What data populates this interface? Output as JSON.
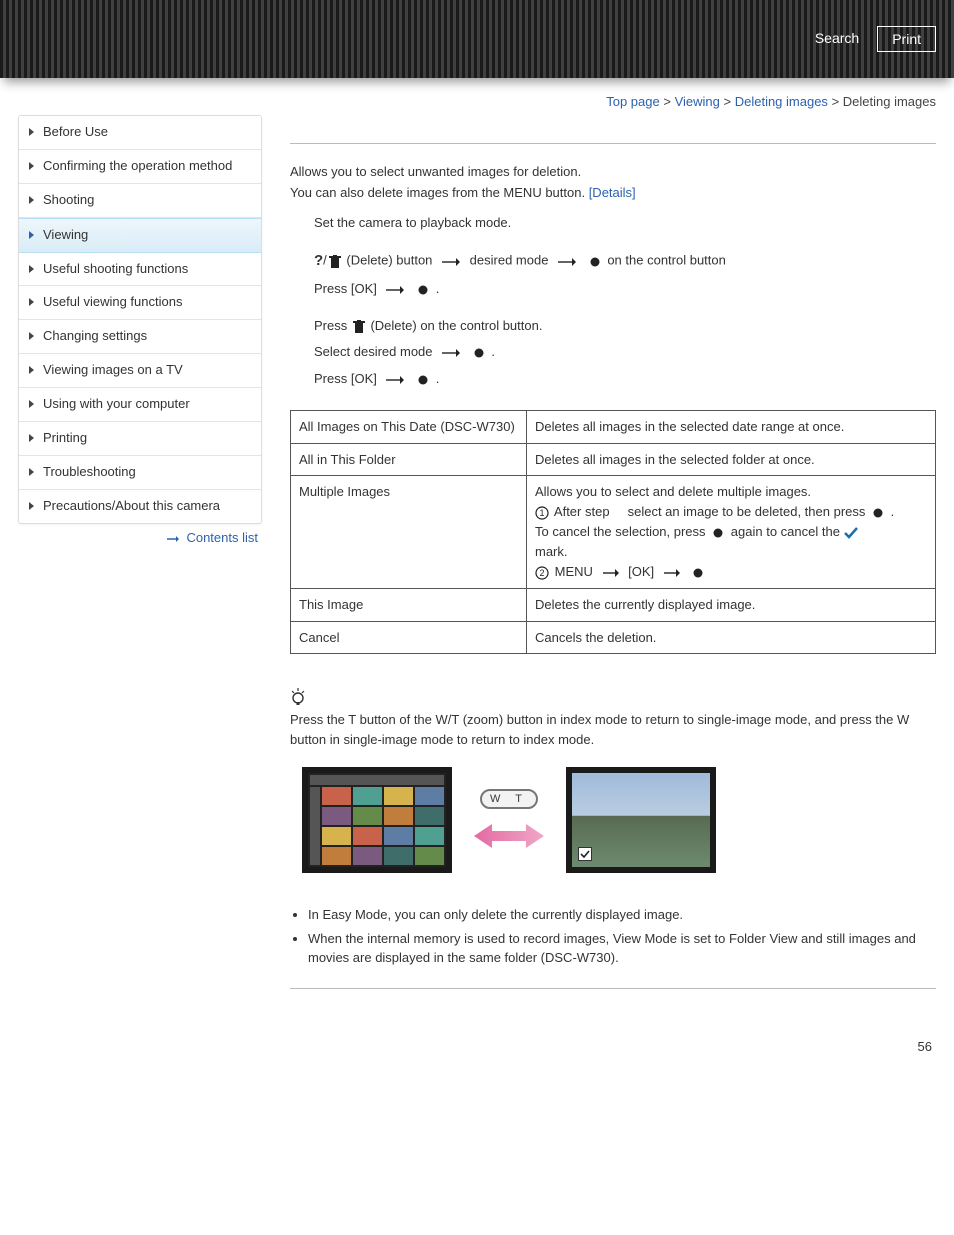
{
  "header": {
    "search": "Search",
    "print": "Print"
  },
  "breadcrumb": {
    "top": "Top page",
    "viewing": "Viewing",
    "deleting": "Deleting images",
    "current": "Deleting images",
    "sep": ">"
  },
  "sidebar": {
    "items": [
      "Before Use",
      "Confirming the operation method",
      "Shooting",
      "Viewing",
      "Useful shooting functions",
      "Useful viewing functions",
      "Changing settings",
      "Viewing images on a TV",
      "Using with your computer",
      "Printing",
      "Troubleshooting",
      "Precautions/About this camera"
    ],
    "contents_list": "Contents list"
  },
  "intro": {
    "line1": "Allows you to select unwanted images for deletion.",
    "line2": "You can also delete images from the MENU button. ",
    "details": "[Details]"
  },
  "steps": {
    "playback": "Set the camera to playback mode.",
    "delete_btn": "(Delete) button",
    "desired_mode": "desired mode",
    "on_control": "on the control button",
    "press_ok": "Press [OK]",
    "dot": ".",
    "press_delete_ctrl": "(Delete) on the control button.",
    "press": "Press ",
    "select_desired": "Select desired mode"
  },
  "table": {
    "r1c1": "All Images on This Date (DSC-W730)",
    "r1c2": "Deletes all images in the selected date range at once.",
    "r2c1": "All in This Folder",
    "r2c2": "Deletes all images in the selected folder at once.",
    "r3c1": "Multiple Images",
    "r3c2_l1": "Allows you to select and delete multiple images.",
    "r3c2_after": "After step",
    "r3c2_select": "select an image to be deleted, then press",
    "r3c2_cancel1": "To cancel the selection, press",
    "r3c2_cancel2": "again to cancel the",
    "r3c2_mark": "mark.",
    "r3c2_menu": "MENU",
    "r3c2_ok": "[OK]",
    "r4c1": "This Image",
    "r4c2": "Deletes the currently displayed image.",
    "r5c1": "Cancel",
    "r5c2": "Cancels the deletion."
  },
  "hint": {
    "text": "Press the T button of the W/T (zoom) button in index mode to return to single-image mode, and press the W button in single-image mode to return to index mode."
  },
  "wt": {
    "label": "W    T"
  },
  "notes": {
    "n1": "In Easy Mode, you can only delete the currently displayed image.",
    "n2": "When the internal memory is used to record images, View Mode is set to Folder View and still images and movies are displayed in the same folder (DSC-W730)."
  },
  "page_number": "56"
}
